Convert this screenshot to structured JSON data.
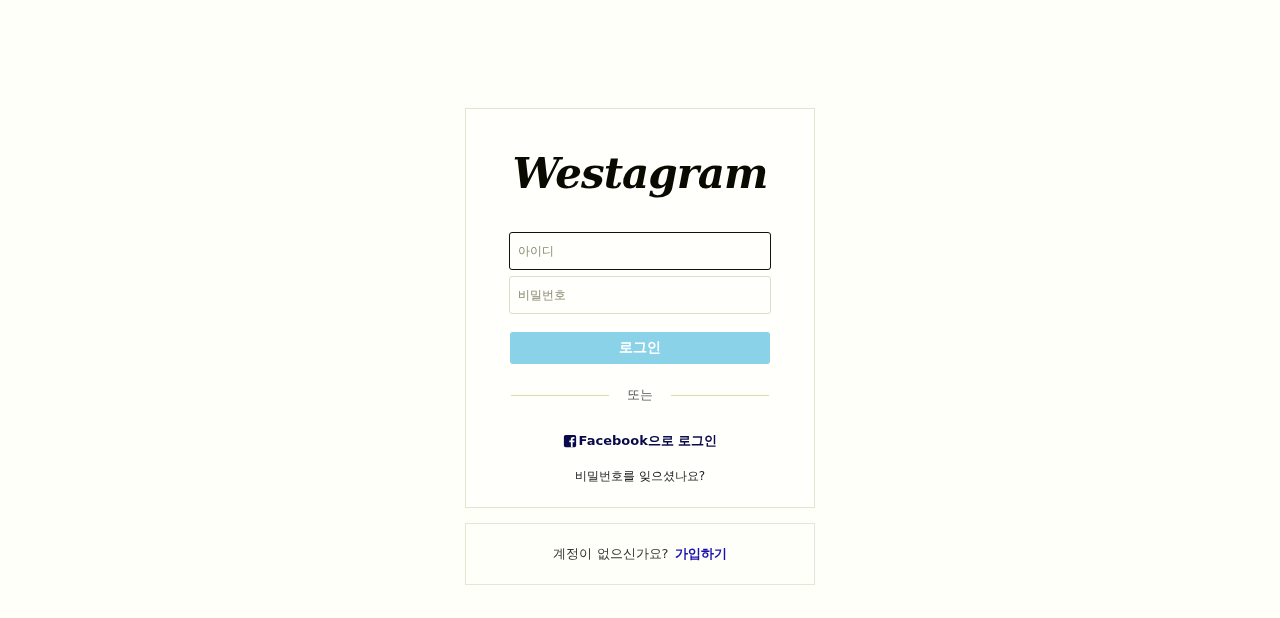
{
  "logo": "Westagram",
  "fields": [
    {
      "placeholder": "아이디",
      "focused": true
    },
    {
      "placeholder": "비밀번호",
      "focused": false
    }
  ],
  "login_button": {
    "label": "로그인",
    "disabled": true
  },
  "divider": "또는",
  "facebook_link": "Facebook으로 로그인",
  "forgot_link": "비밀번호를 잊으셨나요?",
  "signup": {
    "text": "계정이 없으신가요?",
    "link": "가입하기"
  }
}
